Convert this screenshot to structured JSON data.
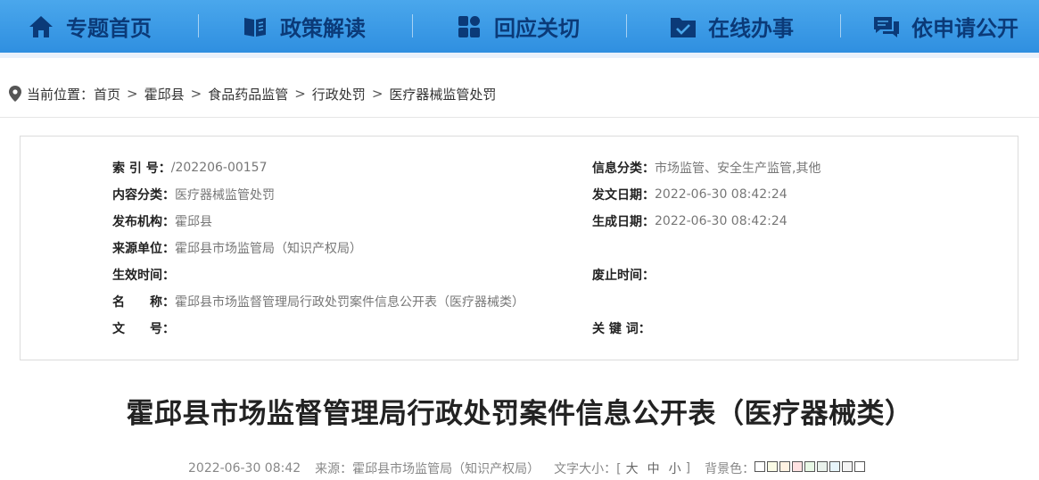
{
  "nav": {
    "items": [
      {
        "label": "专题首页",
        "icon": "home-icon"
      },
      {
        "label": "政策解读",
        "icon": "book-icon"
      },
      {
        "label": "回应关切",
        "icon": "grid-icon"
      },
      {
        "label": "在线办事",
        "icon": "folder-check-icon"
      },
      {
        "label": "依申请公开",
        "icon": "chat-icon"
      }
    ]
  },
  "breadcrumb": {
    "prefix": "当前位置：",
    "items": [
      "首页",
      "霍邱县",
      "食品药品监管",
      "行政处罚",
      "医疗器械监管处罚"
    ],
    "separator": ">"
  },
  "info": {
    "index_label": "索 引 号：",
    "index_value": "/202206-00157",
    "category_label": "信息分类：",
    "category_value": "市场监管、安全生产监管,其他",
    "content_type_label": "内容分类：",
    "content_type_value": "医疗器械监管处罚",
    "issue_date_label": "发文日期：",
    "issue_date_value": "2022-06-30 08:42:24",
    "publisher_label": "发布机构：",
    "publisher_value": "霍邱县",
    "generate_date_label": "生成日期：",
    "generate_date_value": "2022-06-30 08:42:24",
    "source_label": "来源单位：",
    "source_value": "霍邱县市场监管局（知识产权局）",
    "effective_label": "生效时间：",
    "effective_value": "",
    "repeal_label": "废止时间：",
    "repeal_value": "",
    "name_label": "名　　称：",
    "name_value": "霍邱县市场监督管理局行政处罚案件信息公开表（医疗器械类）",
    "doc_no_label": "文　　号：",
    "doc_no_value": "",
    "keywords_label": "关 键 词：",
    "keywords_value": ""
  },
  "article": {
    "title": "霍邱县市场监督管理局行政处罚案件信息公开表（医疗器械类）"
  },
  "meta": {
    "date": "2022-06-30 08:42",
    "source_label": "来源：",
    "source_value": "霍邱县市场监管局（知识产权局）",
    "font_size_label": "文字大小：[",
    "font_large": "大",
    "font_medium": "中",
    "font_small": "小",
    "font_size_end": "]",
    "bg_label": "背景色：",
    "bg_colors": [
      "#ffffff",
      "#fafbe6",
      "#fff2e2",
      "#ffe2e2",
      "#e8f8e6",
      "#eaf2ec",
      "#e7f5fb",
      "#f4f4f4",
      "#ffffff"
    ]
  },
  "colors": {
    "nav_bg": "#3a9ae6",
    "nav_text": "#0b3a78"
  }
}
